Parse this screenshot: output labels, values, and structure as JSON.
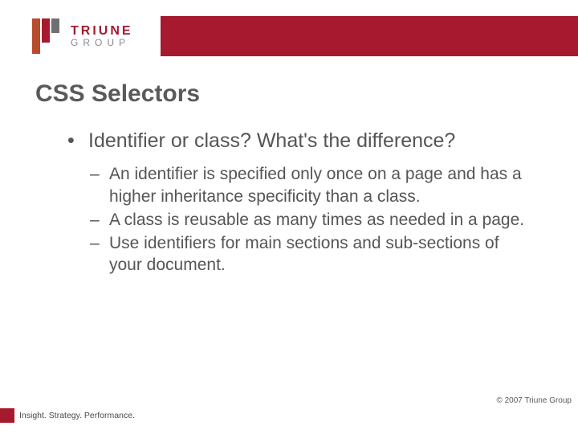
{
  "logo": {
    "top": "TRIUNE",
    "bottom": "GROUP"
  },
  "title": "CSS Selectors",
  "main_bullet": "Identifier or class?  What's the difference?",
  "subs": [
    "An identifier is specified only once on a page and has a higher inheritance specificity than a class.",
    "A class is reusable as many times as needed in a page.",
    "Use identifiers for main sections and sub-sections of your document."
  ],
  "copyright": "© 2007 Triune Group",
  "tagline": "Insight. Strategy. Performance."
}
